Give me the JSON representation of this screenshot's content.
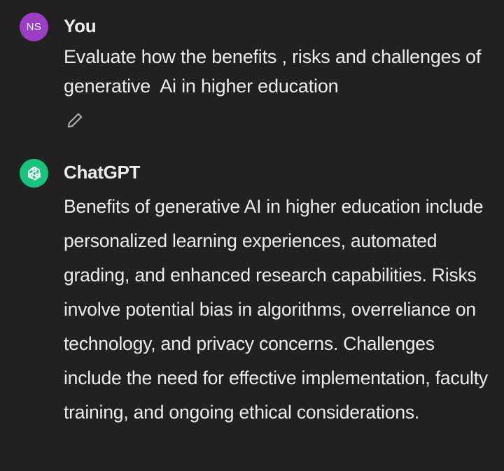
{
  "user_message": {
    "avatar_initials": "NS",
    "avatar_color": "#9a3fc4",
    "author": "You",
    "text": "Evaluate how the benefits , risks and challenges of generative  Ai in higher education",
    "edit_icon": "pencil-icon"
  },
  "assistant_message": {
    "avatar_icon": "openai-logo-icon",
    "avatar_color": "#19c37d",
    "author": "ChatGPT",
    "text": "Benefits of generative AI in higher education include personalized learning experiences, automated grading, and enhanced research capabilities. Risks involve potential bias in algorithms, overreliance on technology, and privacy concerns. Challenges include the need for effective implementation, faculty training, and ongoing ethical considerations."
  },
  "theme": {
    "background": "#212121",
    "text": "#ececec"
  }
}
